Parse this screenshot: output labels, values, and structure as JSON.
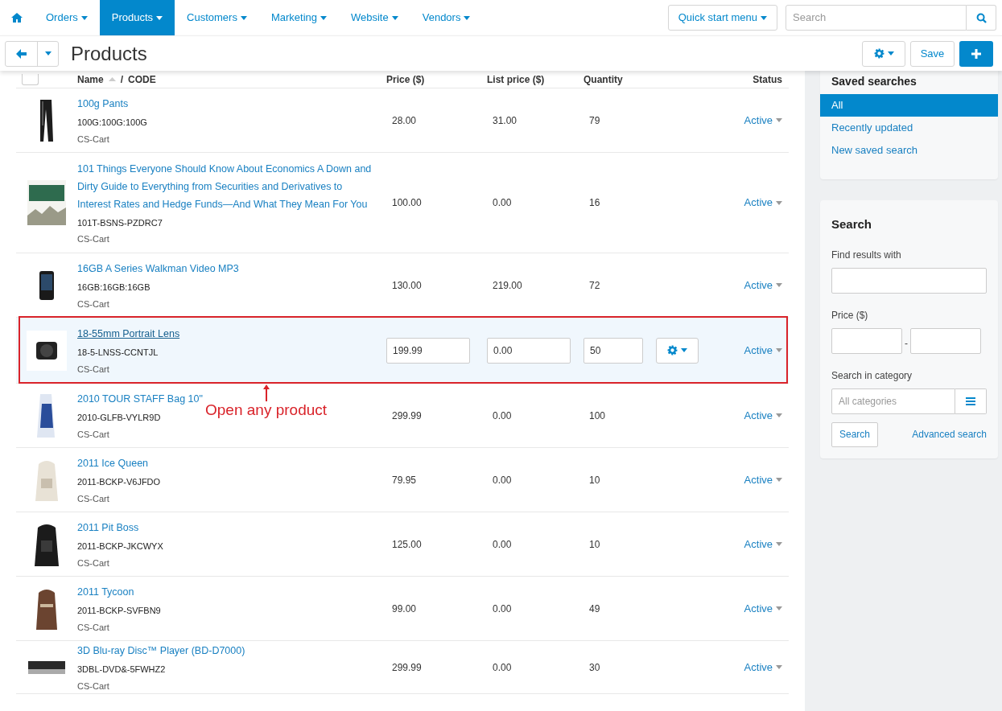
{
  "nav": {
    "items": [
      {
        "label": "Orders",
        "selected": false
      },
      {
        "label": "Products",
        "selected": true
      },
      {
        "label": "Customers",
        "selected": false
      },
      {
        "label": "Marketing",
        "selected": false
      },
      {
        "label": "Website",
        "selected": false
      },
      {
        "label": "Vendors",
        "selected": false
      }
    ],
    "quick_start": "Quick start menu",
    "search": {
      "placeholder": "Search"
    }
  },
  "toolbar": {
    "title": "Products",
    "save": "Save"
  },
  "table": {
    "select_all": {
      "checked": false
    },
    "columns": [
      "Name",
      "/",
      "CODE",
      "Price ($)",
      "List price ($)",
      "Quantity",
      "Status"
    ],
    "rows": [
      {
        "name": "100g Pants",
        "code": "100G:100G:100G",
        "vendor": "CS-Cart",
        "price": "28.00",
        "list_price": "31.00",
        "quantity": "79",
        "status": "Active",
        "selected": false
      },
      {
        "name": "101 Things Everyone Should Know About Economics A Down and Dirty Guide to Everything from Securities and Derivatives to Interest Rates and Hedge Funds—And What They Mean For You",
        "code": "101T-BSNS-PZDRC7",
        "vendor": "CS-Cart",
        "price": "100.00",
        "list_price": "0.00",
        "quantity": "16",
        "status": "Active",
        "selected": false
      },
      {
        "name": "16GB A Series Walkman Video MP3",
        "code": "16GB:16GB:16GB",
        "vendor": "CS-Cart",
        "price": "130.00",
        "list_price": "219.00",
        "quantity": "72",
        "status": "Active",
        "selected": false
      },
      {
        "name": "18-55mm Portrait Lens",
        "code": "18-5-LNSS-CCNTJL",
        "vendor": "CS-Cart",
        "price": "199.99",
        "list_price": "0.00",
        "quantity": "50",
        "status": "Active",
        "selected": true
      },
      {
        "name": "2010 TOUR STAFF Bag 10\"",
        "code": "2010-GLFB-VYLR9D",
        "vendor": "CS-Cart",
        "price": "299.99",
        "list_price": "0.00",
        "quantity": "100",
        "status": "Active",
        "selected": false
      },
      {
        "name": "2011 Ice Queen",
        "code": "2011-BCKP-V6JFDO",
        "vendor": "CS-Cart",
        "price": "79.95",
        "list_price": "0.00",
        "quantity": "10",
        "status": "Active",
        "selected": false
      },
      {
        "name": "2011 Pit Boss",
        "code": "2011-BCKP-JKCWYX",
        "vendor": "CS-Cart",
        "price": "125.00",
        "list_price": "0.00",
        "quantity": "10",
        "status": "Active",
        "selected": false
      },
      {
        "name": "2011 Tycoon",
        "code": "2011-BCKP-SVFBN9",
        "vendor": "CS-Cart",
        "price": "99.00",
        "list_price": "0.00",
        "quantity": "49",
        "status": "Active",
        "selected": false
      },
      {
        "name": "3D Blu-ray Disc™ Player (BD-D7000)",
        "code": "3DBL-DVD&-5FWHZ2",
        "vendor": "CS-Cart",
        "price": "299.99",
        "list_price": "0.00",
        "quantity": "30",
        "status": "Active",
        "selected": false
      }
    ]
  },
  "annotation": "Open any product",
  "sidebar": {
    "saved_searches": {
      "title": "Saved searches",
      "items": [
        {
          "label": "All",
          "selected": true
        },
        {
          "label": "Recently updated",
          "selected": false
        },
        {
          "label": "New saved search",
          "selected": false
        }
      ]
    },
    "search": {
      "title": "Search",
      "find_label": "Find results with",
      "price_label": "Price ($)",
      "range_separator": "-",
      "category_label": "Search in category",
      "category_placeholder": "All categories",
      "search_button": "Search",
      "advanced_link": "Advanced search"
    }
  }
}
